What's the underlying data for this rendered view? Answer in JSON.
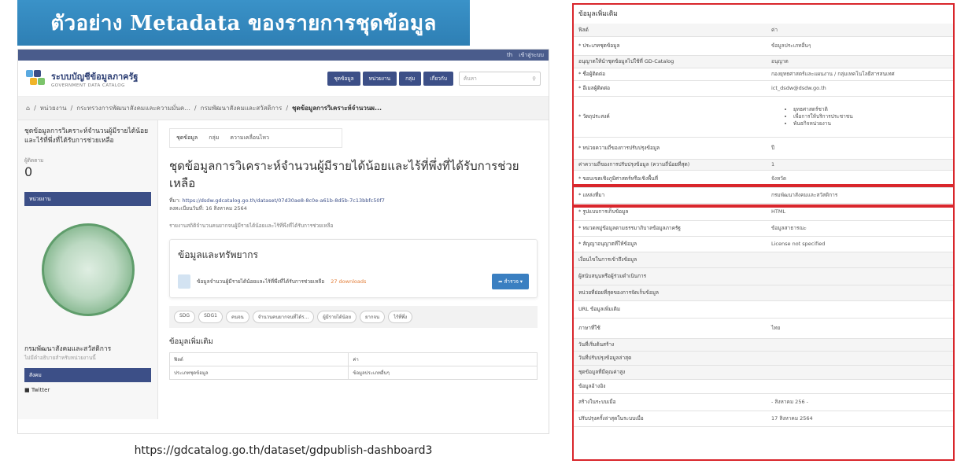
{
  "banner": {
    "title": "ตัวอย่าง Metadata ของรายการชุดข้อมูล"
  },
  "url_caption": "https://gdcatalog.go.th/dataset/gdpublish-dashboard3",
  "portal": {
    "topbar": {
      "lang": "th",
      "login": "เข้าสู่ระบบ"
    },
    "logo_title": "ระบบบัญชีข้อมูลภาครัฐ",
    "logo_subtitle": "GOVERNMENT DATA CATALOG",
    "nav": [
      "ชุดข้อมูล",
      "หน่วยงาน",
      "กลุ่ม",
      "เกี่ยวกับ"
    ],
    "search_placeholder": "ค้นหา",
    "breadcrumb": [
      "หน่วยงาน",
      "กระทรวงการพัฒนาสังคมและความมั่นค...",
      "กรมพัฒนาสังคมและสวัสดิการ",
      "ชุดข้อมูลการวิเคราะห์จำนวนผ..."
    ],
    "sidebar": {
      "title": "ชุดข้อมูลการวิเคราะห์จำนวนผู้มีรายได้น้อยและไร้ที่พึ่งที่ได้รับการช่วยเหลือ",
      "followers_label": "ผู้ติดตาม",
      "followers": "0",
      "org_section": "หน่วยงาน",
      "org_name": "กรมพัฒนาสังคมและสวัสดิการ",
      "org_desc": "ไม่มีคำอธิบายสำหรับหน่วยงานนี้",
      "social_section": "สังคม",
      "twitter": "Twitter"
    },
    "tabs": [
      "ชุดข้อมูล",
      "กลุ่ม",
      "ความเคลื่อนไหว"
    ],
    "dataset_title": "ชุดข้อมูลการวิเคราะห์จำนวนผู้มีรายได้น้อยและไร้ที่พึ่งที่ได้รับการช่วยเหลือ",
    "source_label": "ที่มา:",
    "source_url": "https://dsdw.gdcatalog.go.th/dataset/07d30ae8-8c0e-a61b-8d5b-7c13bbfc50f7",
    "updated": "ลงทะเบียนวันที่: 16 สิงหาคม 2564",
    "description": "รายงานสถิติจำนวนคนยากจนผู้มีรายได้น้อยและไร้ที่พึ่งที่ได้รับการช่วยเหลือ",
    "resources_heading": "ข้อมูลและทรัพยากร",
    "resource_name": "ข้อมูลจำนวนผู้มีรายได้น้อยและไร้ที่พึ่งที่ได้รับการช่วยเหลือ",
    "resource_downloads": "27 downloads",
    "explore_btn": "สำรวจ",
    "tags": [
      "SDG",
      "SDG1",
      "คนจน",
      "จำนวนคนยากจนที่ได้ร...",
      "ผู้มีรายได้น้อย",
      "ยากจน",
      "ไร้ที่พึ่ง"
    ],
    "additional_heading": "ข้อมูลเพิ่มเติม",
    "mini_table": [
      [
        "ฟิลด์",
        "ค่า"
      ],
      [
        "ประเภทชุดข้อมูล",
        "ข้อมูลประเภทอื่นๆ"
      ]
    ]
  },
  "metadata_panel": {
    "heading": "ข้อมูลเพิ่มเติม",
    "rows": [
      {
        "k": "ฟิลด์",
        "v": "ค่า"
      },
      {
        "k": "* ประเภทชุดข้อมูล",
        "v": "ข้อมูลประเภทอื่นๆ"
      },
      {
        "k": "อนุญาตให้นำชุดข้อมูลไปใช้ที่ GD-Catalog",
        "v": "อนุญาต"
      },
      {
        "k": "* ชื่อผู้ติดต่อ",
        "v": "กองยุทธศาสตร์และแผนงาน / กลุ่มเทคโนโลยีสารสนเทศ"
      },
      {
        "k": "* อีเมลผู้ติดต่อ",
        "v": "ict_dsdw@dsdw.go.th"
      },
      {
        "k": "* วัตถุประสงค์",
        "v": [
          "ยุทธศาสตร์ชาติ",
          "เพื่อการให้บริการประชาชน",
          "พันธกิจหน่วยงาน"
        ]
      },
      {
        "k": "* หน่วยความถี่ของการปรับปรุงข้อมูล",
        "v": "ปี"
      },
      {
        "k": "ค่าความถี่ของการปรับปรุงข้อมูล (ความถี่น้อยที่สุด)",
        "v": "1"
      },
      {
        "k": "* ขอบเขตเชิงภูมิศาสตร์หรือเชิงพื้นที่",
        "v": "จังหวัด"
      },
      {
        "k": "* แหล่งที่มา",
        "v": "กรมพัฒนาสังคมและสวัสดิการ"
      },
      {
        "k": "* รูปแบบการเก็บข้อมูล",
        "v": "HTML"
      },
      {
        "k": "* หมวดหมู่ข้อมูลตามธรรมาภิบาลข้อมูลภาครัฐ",
        "v": "ข้อมูลสาธารณะ"
      },
      {
        "k": "* สัญญาอนุญาตที่ให้ข้อมูล",
        "v": "License not specified"
      },
      {
        "k": "เงื่อนไขในการเข้าถึงข้อมูล",
        "v": ""
      },
      {
        "k": "ผู้สนับสนุนหรือผู้ร่วมดำเนินการ",
        "v": ""
      },
      {
        "k": "หน่วยที่ย่อยที่สุดของการจัดเก็บข้อมูล",
        "v": ""
      },
      {
        "k": "URL ข้อมูลเพิ่มเติม",
        "v": ""
      },
      {
        "k": "ภาษาที่ใช้",
        "v": "ไทย"
      },
      {
        "k": "วันที่เริ่มต้นสร้าง",
        "v": ""
      },
      {
        "k": "วันที่ปรับปรุงข้อมูลล่าสุด",
        "v": ""
      },
      {
        "k": "ชุดข้อมูลที่มีคุณค่าสูง",
        "v": ""
      },
      {
        "k": "ข้อมูลอ้างอิง",
        "v": ""
      },
      {
        "k": "สร้างในระบบเมื่อ",
        "v": "- สิงหาคม 256 -"
      },
      {
        "k": "ปรับปรุงครั้งล่าสุดในระบบเมื่อ",
        "v": "17 สิงหาคม 2564"
      }
    ]
  },
  "colors": {
    "banner": "#2e7fb4",
    "nav": "#3c4f87",
    "highlight": "#d9262c",
    "explore": "#3a7fc1"
  }
}
